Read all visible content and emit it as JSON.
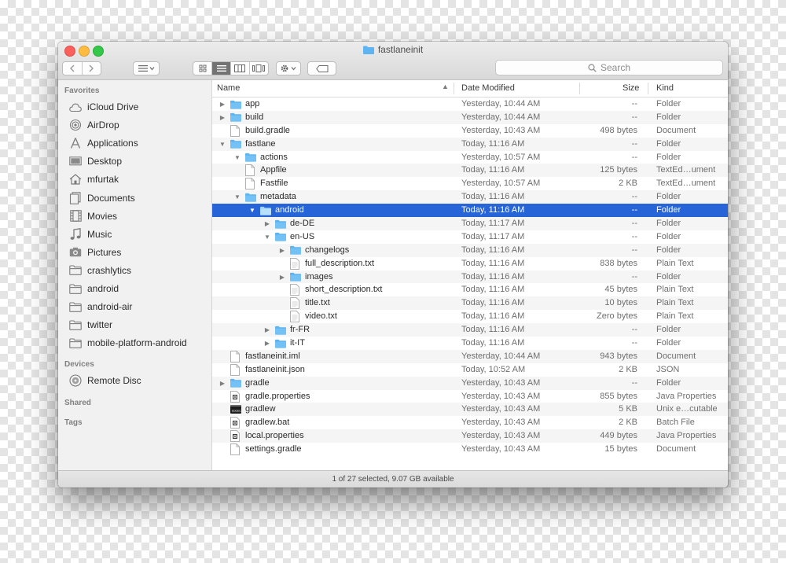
{
  "window": {
    "title": "fastlaneinit",
    "status": "1 of 27 selected, 9.07 GB available"
  },
  "toolbar": {
    "search_placeholder": "Search"
  },
  "sidebar": {
    "favorites_label": "Favorites",
    "favorites": [
      {
        "label": "iCloud Drive",
        "icon": "cloud-icon"
      },
      {
        "label": "AirDrop",
        "icon": "airdrop-icon"
      },
      {
        "label": "Applications",
        "icon": "applications-icon"
      },
      {
        "label": "Desktop",
        "icon": "desktop-icon"
      },
      {
        "label": "mfurtak",
        "icon": "home-icon"
      },
      {
        "label": "Documents",
        "icon": "documents-icon"
      },
      {
        "label": "Movies",
        "icon": "movies-icon"
      },
      {
        "label": "Music",
        "icon": "music-icon"
      },
      {
        "label": "Pictures",
        "icon": "pictures-icon"
      },
      {
        "label": "crashlytics",
        "icon": "folder-icon"
      },
      {
        "label": "android",
        "icon": "folder-icon"
      },
      {
        "label": "android-air",
        "icon": "folder-icon"
      },
      {
        "label": "twitter",
        "icon": "folder-icon"
      },
      {
        "label": "mobile-platform-android",
        "icon": "folder-icon"
      }
    ],
    "devices_label": "Devices",
    "devices": [
      {
        "label": "Remote Disc",
        "icon": "disc-icon"
      }
    ],
    "shared_label": "Shared",
    "tags_label": "Tags"
  },
  "columns": {
    "name": "Name",
    "date": "Date Modified",
    "size": "Size",
    "kind": "Kind"
  },
  "files": [
    {
      "name": "app",
      "depth": 0,
      "type": "folder",
      "expanded": false,
      "date": "Yesterday, 10:44 AM",
      "size": "--",
      "kind": "Folder"
    },
    {
      "name": "build",
      "depth": 0,
      "type": "folder",
      "expanded": false,
      "date": "Yesterday, 10:44 AM",
      "size": "--",
      "kind": "Folder"
    },
    {
      "name": "build.gradle",
      "depth": 0,
      "type": "doc",
      "date": "Yesterday, 10:43 AM",
      "size": "498 bytes",
      "kind": "Document"
    },
    {
      "name": "fastlane",
      "depth": 0,
      "type": "folder",
      "expanded": true,
      "date": "Today, 11:16 AM",
      "size": "--",
      "kind": "Folder"
    },
    {
      "name": "actions",
      "depth": 1,
      "type": "folder",
      "expanded": true,
      "date": "Yesterday, 10:57 AM",
      "size": "--",
      "kind": "Folder"
    },
    {
      "name": "Appfile",
      "depth": 1,
      "type": "doc",
      "date": "Today, 11:16 AM",
      "size": "125 bytes",
      "kind": "TextEd…ument"
    },
    {
      "name": "Fastfile",
      "depth": 1,
      "type": "doc",
      "date": "Yesterday, 10:57 AM",
      "size": "2 KB",
      "kind": "TextEd…ument"
    },
    {
      "name": "metadata",
      "depth": 1,
      "type": "folder",
      "expanded": true,
      "date": "Today, 11:16 AM",
      "size": "--",
      "kind": "Folder"
    },
    {
      "name": "android",
      "depth": 2,
      "type": "folder",
      "expanded": true,
      "selected": true,
      "date": "Today, 11:16 AM",
      "size": "--",
      "kind": "Folder"
    },
    {
      "name": "de-DE",
      "depth": 3,
      "type": "folder",
      "expanded": false,
      "date": "Today, 11:17 AM",
      "size": "--",
      "kind": "Folder"
    },
    {
      "name": "en-US",
      "depth": 3,
      "type": "folder",
      "expanded": true,
      "date": "Today, 11:17 AM",
      "size": "--",
      "kind": "Folder"
    },
    {
      "name": "changelogs",
      "depth": 4,
      "type": "folder",
      "expanded": false,
      "date": "Today, 11:16 AM",
      "size": "--",
      "kind": "Folder"
    },
    {
      "name": "full_description.txt",
      "depth": 4,
      "type": "text",
      "date": "Today, 11:16 AM",
      "size": "838 bytes",
      "kind": "Plain Text"
    },
    {
      "name": "images",
      "depth": 4,
      "type": "folder",
      "expanded": false,
      "date": "Today, 11:16 AM",
      "size": "--",
      "kind": "Folder"
    },
    {
      "name": "short_description.txt",
      "depth": 4,
      "type": "text",
      "date": "Today, 11:16 AM",
      "size": "45 bytes",
      "kind": "Plain Text"
    },
    {
      "name": "title.txt",
      "depth": 4,
      "type": "text",
      "date": "Today, 11:16 AM",
      "size": "10 bytes",
      "kind": "Plain Text"
    },
    {
      "name": "video.txt",
      "depth": 4,
      "type": "text",
      "date": "Today, 11:16 AM",
      "size": "Zero bytes",
      "kind": "Plain Text"
    },
    {
      "name": "fr-FR",
      "depth": 3,
      "type": "folder",
      "expanded": false,
      "date": "Today, 11:16 AM",
      "size": "--",
      "kind": "Folder"
    },
    {
      "name": "it-IT",
      "depth": 3,
      "type": "folder",
      "expanded": false,
      "date": "Today, 11:16 AM",
      "size": "--",
      "kind": "Folder"
    },
    {
      "name": "fastlaneinit.iml",
      "depth": 0,
      "type": "doc",
      "date": "Yesterday, 10:44 AM",
      "size": "943 bytes",
      "kind": "Document"
    },
    {
      "name": "fastlaneinit.json",
      "depth": 0,
      "type": "doc",
      "date": "Today, 10:52 AM",
      "size": "2 KB",
      "kind": "JSON"
    },
    {
      "name": "gradle",
      "depth": 0,
      "type": "folder",
      "expanded": false,
      "date": "Yesterday, 10:43 AM",
      "size": "--",
      "kind": "Folder"
    },
    {
      "name": "gradle.properties",
      "depth": 0,
      "type": "props",
      "date": "Yesterday, 10:43 AM",
      "size": "855 bytes",
      "kind": "Java Properties"
    },
    {
      "name": "gradlew",
      "depth": 0,
      "type": "exec",
      "date": "Yesterday, 10:43 AM",
      "size": "5 KB",
      "kind": "Unix e…cutable"
    },
    {
      "name": "gradlew.bat",
      "depth": 0,
      "type": "props",
      "date": "Yesterday, 10:43 AM",
      "size": "2 KB",
      "kind": "Batch File"
    },
    {
      "name": "local.properties",
      "depth": 0,
      "type": "props",
      "date": "Yesterday, 10:43 AM",
      "size": "449 bytes",
      "kind": "Java Properties"
    },
    {
      "name": "settings.gradle",
      "depth": 0,
      "type": "doc",
      "date": "Yesterday, 10:43 AM",
      "size": "15 bytes",
      "kind": "Document"
    }
  ],
  "colors": {
    "selection": "#2764d7",
    "folder": "#5db4f0",
    "close": "#fc605c",
    "minimize": "#fdbc40",
    "maximize": "#34c84a"
  }
}
